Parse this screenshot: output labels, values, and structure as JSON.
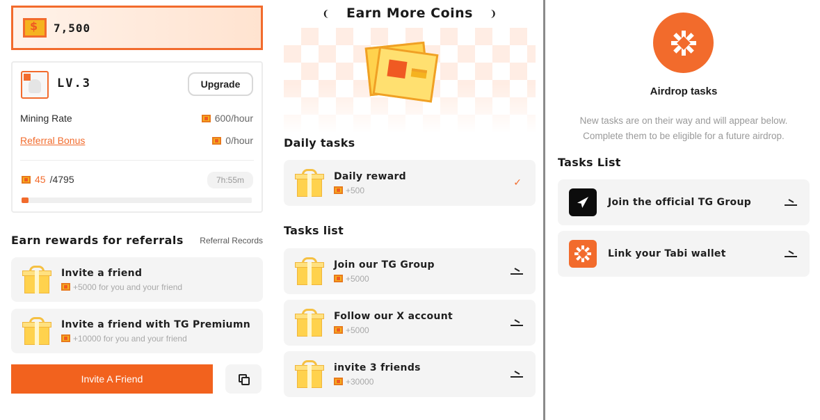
{
  "balance": {
    "amount": "7,500"
  },
  "level": {
    "label": "LV.3",
    "upgrade_label": "Upgrade",
    "mining_rate_label": "Mining Rate",
    "mining_rate_value": "600/hour",
    "referral_bonus_label": "Referral Bonus",
    "referral_bonus_value": "0/hour",
    "progress_current": "45",
    "progress_total": "/4795",
    "progress_fraction": 0.0094,
    "timer": "7h:55m"
  },
  "referrals": {
    "heading": "Earn rewards for referrals",
    "records_link": "Referral Records",
    "items": [
      {
        "title": "Invite a friend",
        "reward": "+5000 for you and your friend"
      },
      {
        "title": "Invite a friend with TG Premiumn",
        "reward": "+10000 for you and your friend"
      }
    ],
    "invite_button": "Invite A Friend"
  },
  "earn": {
    "title": "Earn More Coins",
    "bracket_left": "❨",
    "bracket_right": "❩",
    "daily_heading": "Daily tasks",
    "daily": [
      {
        "title": "Daily reward",
        "reward": "+500",
        "status": "done"
      }
    ],
    "tasks_heading": "Tasks list",
    "tasks": [
      {
        "title": "Join our TG Group",
        "reward": "+5000"
      },
      {
        "title": "Follow our X account",
        "reward": "+5000"
      },
      {
        "title": "invite 3 friends",
        "reward": "+30000"
      }
    ]
  },
  "airdrop": {
    "title": "Airdrop tasks",
    "subtitle_line1": "New tasks are on their way and will appear below.",
    "subtitle_line2": "Complete them to be eligible for a future airdrop.",
    "list_heading": "Tasks List",
    "items": [
      {
        "title": "Join the official TG Group",
        "icon": "telegram-icon"
      },
      {
        "title": "Link your Tabi wallet",
        "icon": "tabi-icon"
      }
    ]
  },
  "colors": {
    "accent": "#f26b2c",
    "card": "#f4f4f4",
    "coin": "#f5b21f"
  }
}
